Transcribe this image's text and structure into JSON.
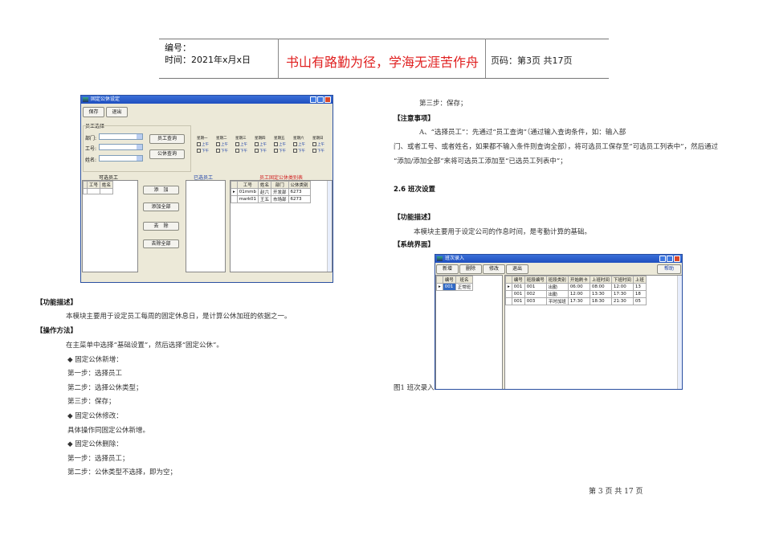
{
  "header": {
    "number_label": "编号：",
    "time_label": "时间：2021年x月x日",
    "motto": "书山有路勤为径，学海无涯苦作舟",
    "page_label": "页码：第3页 共17页"
  },
  "window1": {
    "title": "固定公休设定",
    "toolbar": [
      "保存",
      "退出"
    ],
    "group_title": "员工选择",
    "fields": [
      "部门:",
      "工号:",
      "姓名:"
    ],
    "query_buttons": [
      "员工查询",
      "公休查询"
    ],
    "weekdays": [
      "星期一",
      "星期二",
      "星期三",
      "星期四",
      "星期五",
      "星期六",
      "星期日"
    ],
    "am": "上午",
    "pm": "下午",
    "available_label": "可选员工",
    "selected_label": "已选员工",
    "table_label": "员工固定公休类别表",
    "available_columns": [
      "工号",
      "姓名"
    ],
    "action_buttons": [
      "添　加",
      "添加全部",
      "去　除",
      "去除全部"
    ],
    "table_columns": [
      "工号",
      "姓名",
      "部门",
      "公休类别"
    ],
    "rows": [
      [
        "01mmb",
        "赵六",
        "开发部",
        "6273"
      ],
      [
        "mark01",
        "王五",
        "市场部",
        "6273"
      ]
    ]
  },
  "left": {
    "h1": "【功能描述】",
    "p1": "本模块主要用于设定员工每周的固定休息日，是计算公休加班的依据之一。",
    "h2": "【操作方法】",
    "lines": [
      "在主菜单中选择“基础设置”，然后选择“固定公休”。",
      "◆ 固定公休新增：",
      "第一步：选择员工",
      "第二步：选择公休类型；",
      "第三步：保存；",
      "◆ 固定公休修改：",
      "具体操作同固定公休新增。",
      "◆ 固定公休删除：",
      "第一步：选择员工；",
      "第二步：公休类型不选择，即为空；"
    ]
  },
  "right": {
    "step3": "第三步：保存；",
    "h_notice": "【注意事项】",
    "notice1": "A、“选择员工”：先通过“员工查询”（通过输入查询条件，如：输入部",
    "notice2": "门、或者工号、或者姓名，如果都不输入条件则查询全部），将可选员工保存至“可选员工列表中”，然后通过",
    "notice3": "“添加/添加全部”来将可选员工添加至“已选员工列表中”；",
    "section": "2.6 班次设置",
    "h_func": "【功能描述】",
    "func": "本模块主要用于设定公司的作息时间，是考勤计算的基础。",
    "h_ui": "【系统界面】",
    "caption": "图1 班次录入"
  },
  "window2": {
    "title": "班次录入",
    "toolbar": [
      "新增",
      "删除",
      "修改",
      "退出"
    ],
    "help": "帮助",
    "left_columns": [
      "编号",
      "班名"
    ],
    "left_rows": [
      [
        "001",
        "正常班"
      ]
    ],
    "columns": [
      "编号",
      "班段编号",
      "班段类别",
      "开始刷卡",
      "上班时间",
      "下班时间",
      "上班"
    ],
    "rows": [
      [
        "001",
        "001",
        "出勤",
        "06:00",
        "08:00",
        "12:00",
        "13"
      ],
      [
        "001",
        "002",
        "出勤",
        "12:00",
        "13:30",
        "17:30",
        "18"
      ],
      [
        "001",
        "003",
        "平时加班",
        "17:30",
        "18:30",
        "21:30",
        "05"
      ]
    ]
  },
  "footer": {
    "page": "第 3 页 共 17 页"
  }
}
